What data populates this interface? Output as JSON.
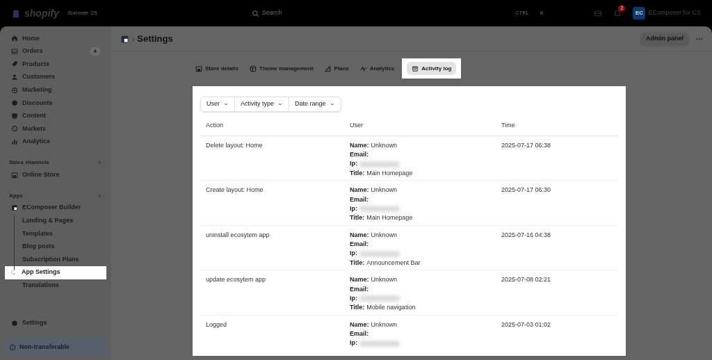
{
  "topbar": {
    "brand": "shopify",
    "edition": "Summer '25",
    "search_placeholder": "Search",
    "shortcut": [
      "CTRL",
      "K"
    ],
    "notifications": "2",
    "avatar": "EC",
    "store": "EComposer for CS"
  },
  "sidebar": {
    "items": [
      {
        "label": "Home",
        "selected": false
      },
      {
        "label": "Orders",
        "badge": "4",
        "selected": false
      },
      {
        "label": "Products",
        "selected": false
      },
      {
        "label": "Customers",
        "selected": false
      },
      {
        "label": "Marketing",
        "selected": false
      },
      {
        "label": "Discounts",
        "selected": false
      },
      {
        "label": "Content",
        "selected": false
      },
      {
        "label": "Markets",
        "selected": false
      },
      {
        "label": "Analytics",
        "selected": false
      }
    ],
    "sections": [
      {
        "title": "Sales channels",
        "items": [
          {
            "label": "Online Store",
            "selected": false
          }
        ]
      },
      {
        "title": "Apps",
        "items": [
          {
            "label": "EComposer Builder",
            "selected": false,
            "children": [
              {
                "label": "Landing & Pages",
                "selected": false
              },
              {
                "label": "Templates",
                "selected": false
              },
              {
                "label": "Blog posts",
                "selected": false
              },
              {
                "label": "Subscription Plans",
                "selected": false
              },
              {
                "label": "App Settings",
                "selected": true
              },
              {
                "label": "Translations",
                "selected": false
              }
            ]
          }
        ]
      }
    ],
    "settings": "Settings",
    "notice": "Non-transferable"
  },
  "page": {
    "separator": "›",
    "title": "Settings",
    "primary_action": "Admin panel",
    "more": "···"
  },
  "tabs": [
    {
      "label": "Store details",
      "selected": false
    },
    {
      "label": "Theme management",
      "selected": false
    },
    {
      "label": "Plans",
      "selected": false
    },
    {
      "label": "Analytics",
      "selected": false
    },
    {
      "label": "Activity log",
      "selected": true
    }
  ],
  "filters": [
    "User",
    "Activity type",
    "Date range"
  ],
  "table": {
    "columns": [
      "Action",
      "User",
      "Time"
    ],
    "rows": [
      {
        "action": "Delete layout: Home",
        "user": [
          {
            "label": "Name:",
            "value": "Unknown"
          },
          {
            "label": "Email:"
          },
          {
            "label": "Ip:",
            "redacted": true
          },
          {
            "label": "Title:",
            "value": "Main Homepage"
          }
        ],
        "time": "2025-07-17 06:38"
      },
      {
        "action": "Create layout: Home",
        "user": [
          {
            "label": "Name:",
            "value": "Unknown"
          },
          {
            "label": "Email:"
          },
          {
            "label": "Ip:",
            "redacted": true
          },
          {
            "label": "Title:",
            "value": "Main Homepage"
          }
        ],
        "time": "2025-07-17 06:30"
      },
      {
        "action": "uninstall ecosytem app",
        "user": [
          {
            "label": "Name:",
            "value": "Unknown"
          },
          {
            "label": "Email:"
          },
          {
            "label": "Ip:",
            "redacted": true
          },
          {
            "label": "Title:",
            "value": "Announcement Bar"
          }
        ],
        "time": "2025-07-16 04:38"
      },
      {
        "action": "update ecosytem app",
        "user": [
          {
            "label": "Name:",
            "value": "Unknown"
          },
          {
            "label": "Email:"
          },
          {
            "label": "Ip:",
            "redacted": true
          },
          {
            "label": "Title:",
            "value": "Mobile navigation"
          }
        ],
        "time": "2025-07-08 02:21"
      },
      {
        "action": "Logged",
        "user": [
          {
            "label": "Name:",
            "value": "Unknown"
          },
          {
            "label": "Email:"
          },
          {
            "label": "Ip:",
            "redacted": true
          }
        ],
        "time": "2025-07-03 01:02"
      }
    ]
  }
}
